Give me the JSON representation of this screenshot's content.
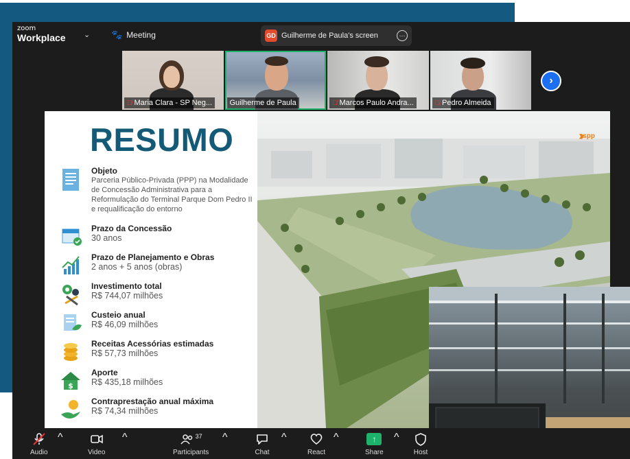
{
  "topbar": {
    "brand_small": "zoom",
    "brand_main": "Workplace",
    "meeting_label": "Meeting",
    "screen_initials": "GD",
    "screen_label": "Guilherme de Paula's screen",
    "more_glyph": "⋯"
  },
  "participants": [
    {
      "name": "Maria Clara - SP Neg...",
      "muted": true
    },
    {
      "name": "Guilherme de Paula",
      "muted": false,
      "active": true
    },
    {
      "name": "Marcos Paulo Andra...",
      "muted": true
    },
    {
      "name": "Pedro Almeida",
      "muted": true
    }
  ],
  "next_glyph": "›",
  "slide": {
    "title": "RESUMO",
    "logo_text": "spp",
    "items": [
      {
        "label": "Objeto",
        "value": "Parceria Público-Privada (PPP) na Modalidade de Concessão Administrativa para a Reformulação do Terminal Parque Dom Pedro II e requalificação do entorno",
        "icon": "document-icon"
      },
      {
        "label": "Prazo da Concessão",
        "value": "30 anos",
        "icon": "calendar-icon"
      },
      {
        "label": "Prazo de Planejamento e Obras",
        "value": "2 anos + 5 anos (obras)",
        "icon": "growth-chart-icon"
      },
      {
        "label": "Investimento total",
        "value": "R$ 744,07 milhões",
        "icon": "gears-tools-icon"
      },
      {
        "label": "Custeio anual",
        "value": "R$ 46,09 milhões",
        "icon": "bill-icon"
      },
      {
        "label": "Receitas Acessórias estimadas",
        "value": "R$ 57,73 milhões",
        "icon": "coins-icon"
      },
      {
        "label": "Aporte",
        "value": "R$ 435,18 milhões",
        "icon": "house-dollar-icon"
      },
      {
        "label": "Contraprestação anual máxima",
        "value": "R$ 74,34 milhões",
        "icon": "payment-hand-icon"
      }
    ]
  },
  "controls": {
    "audio": "Audio",
    "video": "Video",
    "participants": "Participants",
    "participants_count": "37",
    "chat": "Chat",
    "react": "React",
    "share": "Share",
    "host": "Host"
  },
  "colors": {
    "title": "#145a76",
    "background_blue": "#14597f",
    "active_speaker": "#1fb26b",
    "share_green": "#1fb26b",
    "next_blue": "#1d6ff2"
  }
}
